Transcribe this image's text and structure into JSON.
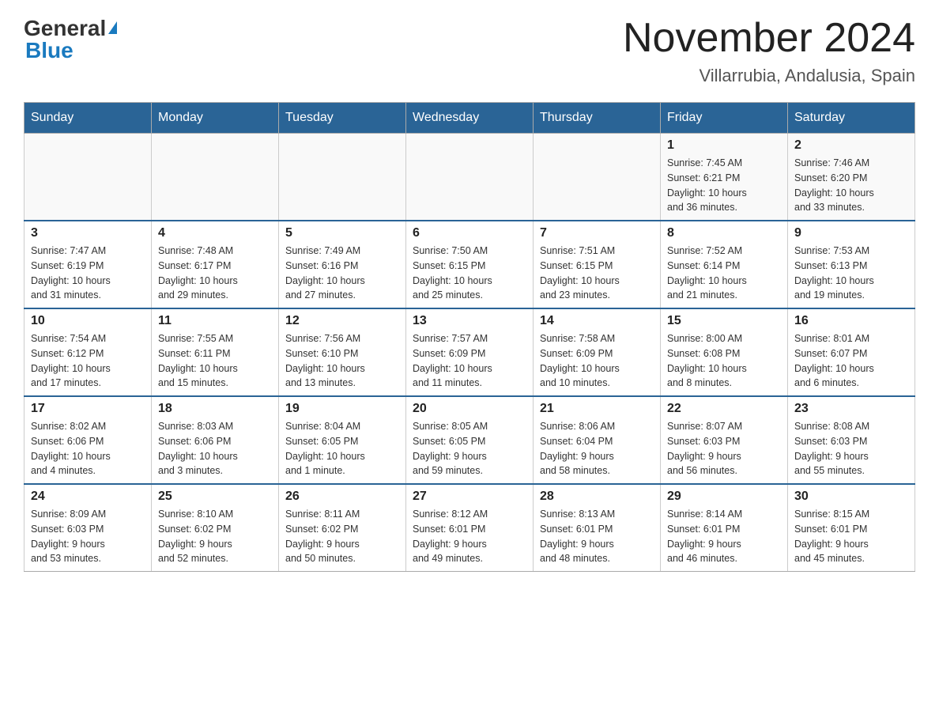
{
  "header": {
    "logo_general": "General",
    "logo_blue": "Blue",
    "main_title": "November 2024",
    "subtitle": "Villarrubia, Andalusia, Spain"
  },
  "days_of_week": [
    "Sunday",
    "Monday",
    "Tuesday",
    "Wednesday",
    "Thursday",
    "Friday",
    "Saturday"
  ],
  "weeks": [
    [
      {
        "day": "",
        "info": ""
      },
      {
        "day": "",
        "info": ""
      },
      {
        "day": "",
        "info": ""
      },
      {
        "day": "",
        "info": ""
      },
      {
        "day": "",
        "info": ""
      },
      {
        "day": "1",
        "info": "Sunrise: 7:45 AM\nSunset: 6:21 PM\nDaylight: 10 hours\nand 36 minutes."
      },
      {
        "day": "2",
        "info": "Sunrise: 7:46 AM\nSunset: 6:20 PM\nDaylight: 10 hours\nand 33 minutes."
      }
    ],
    [
      {
        "day": "3",
        "info": "Sunrise: 7:47 AM\nSunset: 6:19 PM\nDaylight: 10 hours\nand 31 minutes."
      },
      {
        "day": "4",
        "info": "Sunrise: 7:48 AM\nSunset: 6:17 PM\nDaylight: 10 hours\nand 29 minutes."
      },
      {
        "day": "5",
        "info": "Sunrise: 7:49 AM\nSunset: 6:16 PM\nDaylight: 10 hours\nand 27 minutes."
      },
      {
        "day": "6",
        "info": "Sunrise: 7:50 AM\nSunset: 6:15 PM\nDaylight: 10 hours\nand 25 minutes."
      },
      {
        "day": "7",
        "info": "Sunrise: 7:51 AM\nSunset: 6:15 PM\nDaylight: 10 hours\nand 23 minutes."
      },
      {
        "day": "8",
        "info": "Sunrise: 7:52 AM\nSunset: 6:14 PM\nDaylight: 10 hours\nand 21 minutes."
      },
      {
        "day": "9",
        "info": "Sunrise: 7:53 AM\nSunset: 6:13 PM\nDaylight: 10 hours\nand 19 minutes."
      }
    ],
    [
      {
        "day": "10",
        "info": "Sunrise: 7:54 AM\nSunset: 6:12 PM\nDaylight: 10 hours\nand 17 minutes."
      },
      {
        "day": "11",
        "info": "Sunrise: 7:55 AM\nSunset: 6:11 PM\nDaylight: 10 hours\nand 15 minutes."
      },
      {
        "day": "12",
        "info": "Sunrise: 7:56 AM\nSunset: 6:10 PM\nDaylight: 10 hours\nand 13 minutes."
      },
      {
        "day": "13",
        "info": "Sunrise: 7:57 AM\nSunset: 6:09 PM\nDaylight: 10 hours\nand 11 minutes."
      },
      {
        "day": "14",
        "info": "Sunrise: 7:58 AM\nSunset: 6:09 PM\nDaylight: 10 hours\nand 10 minutes."
      },
      {
        "day": "15",
        "info": "Sunrise: 8:00 AM\nSunset: 6:08 PM\nDaylight: 10 hours\nand 8 minutes."
      },
      {
        "day": "16",
        "info": "Sunrise: 8:01 AM\nSunset: 6:07 PM\nDaylight: 10 hours\nand 6 minutes."
      }
    ],
    [
      {
        "day": "17",
        "info": "Sunrise: 8:02 AM\nSunset: 6:06 PM\nDaylight: 10 hours\nand 4 minutes."
      },
      {
        "day": "18",
        "info": "Sunrise: 8:03 AM\nSunset: 6:06 PM\nDaylight: 10 hours\nand 3 minutes."
      },
      {
        "day": "19",
        "info": "Sunrise: 8:04 AM\nSunset: 6:05 PM\nDaylight: 10 hours\nand 1 minute."
      },
      {
        "day": "20",
        "info": "Sunrise: 8:05 AM\nSunset: 6:05 PM\nDaylight: 9 hours\nand 59 minutes."
      },
      {
        "day": "21",
        "info": "Sunrise: 8:06 AM\nSunset: 6:04 PM\nDaylight: 9 hours\nand 58 minutes."
      },
      {
        "day": "22",
        "info": "Sunrise: 8:07 AM\nSunset: 6:03 PM\nDaylight: 9 hours\nand 56 minutes."
      },
      {
        "day": "23",
        "info": "Sunrise: 8:08 AM\nSunset: 6:03 PM\nDaylight: 9 hours\nand 55 minutes."
      }
    ],
    [
      {
        "day": "24",
        "info": "Sunrise: 8:09 AM\nSunset: 6:03 PM\nDaylight: 9 hours\nand 53 minutes."
      },
      {
        "day": "25",
        "info": "Sunrise: 8:10 AM\nSunset: 6:02 PM\nDaylight: 9 hours\nand 52 minutes."
      },
      {
        "day": "26",
        "info": "Sunrise: 8:11 AM\nSunset: 6:02 PM\nDaylight: 9 hours\nand 50 minutes."
      },
      {
        "day": "27",
        "info": "Sunrise: 8:12 AM\nSunset: 6:01 PM\nDaylight: 9 hours\nand 49 minutes."
      },
      {
        "day": "28",
        "info": "Sunrise: 8:13 AM\nSunset: 6:01 PM\nDaylight: 9 hours\nand 48 minutes."
      },
      {
        "day": "29",
        "info": "Sunrise: 8:14 AM\nSunset: 6:01 PM\nDaylight: 9 hours\nand 46 minutes."
      },
      {
        "day": "30",
        "info": "Sunrise: 8:15 AM\nSunset: 6:01 PM\nDaylight: 9 hours\nand 45 minutes."
      }
    ]
  ]
}
